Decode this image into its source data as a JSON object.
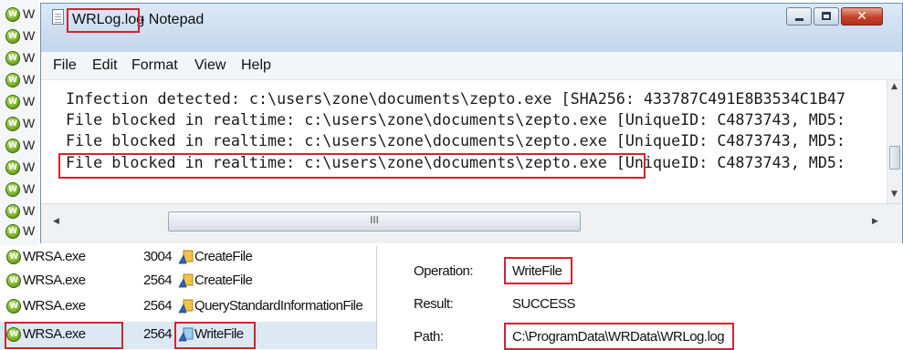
{
  "notepad": {
    "title_file": "WRLog.log",
    "title_app": "- Notepad",
    "menu": [
      "File",
      "Edit",
      "Format",
      "View",
      "Help"
    ],
    "lines": [
      "Infection detected: c:\\users\\zone\\documents\\zepto.exe [SHA256: 433787C491E8B3534C1B47",
      "File blocked in realtime: c:\\users\\zone\\documents\\zepto.exe [UniqueID: C4873743, MD5:",
      "File blocked in realtime: c:\\users\\zone\\documents\\zepto.exe [UniqueID: C4873743, MD5:",
      "File blocked in realtime: c:\\users\\zone\\documents\\zepto.exe [UniqueID: C4873743, MD5:"
    ],
    "hscroll_grip": "III"
  },
  "procmon": {
    "left_strip_letter": "W",
    "rows": [
      {
        "process": "WRSA.exe",
        "pid": "3004",
        "operation": "CreateFile"
      },
      {
        "process": "WRSA.exe",
        "pid": "2564",
        "operation": "CreateFile"
      },
      {
        "process": "WRSA.exe",
        "pid": "2564",
        "operation": "QueryStandardInformationFile"
      },
      {
        "process": "WRSA.exe",
        "pid": "2564",
        "operation": "WriteFile"
      }
    ],
    "details": {
      "operation_label": "Operation:",
      "operation_value": "WriteFile",
      "result_label": "Result:",
      "result_value": "SUCCESS",
      "path_label": "Path:",
      "path_value": "C:\\ProgramData\\WRData\\WRLog.log"
    }
  },
  "colors": {
    "highlight_box": "#d1242f",
    "selected_row": "#dde8f5",
    "titlebar": "#c9dcef"
  },
  "icons": {
    "process_icon": "webroot-w-icon",
    "operation_icon": "filesystem-op-icon"
  }
}
